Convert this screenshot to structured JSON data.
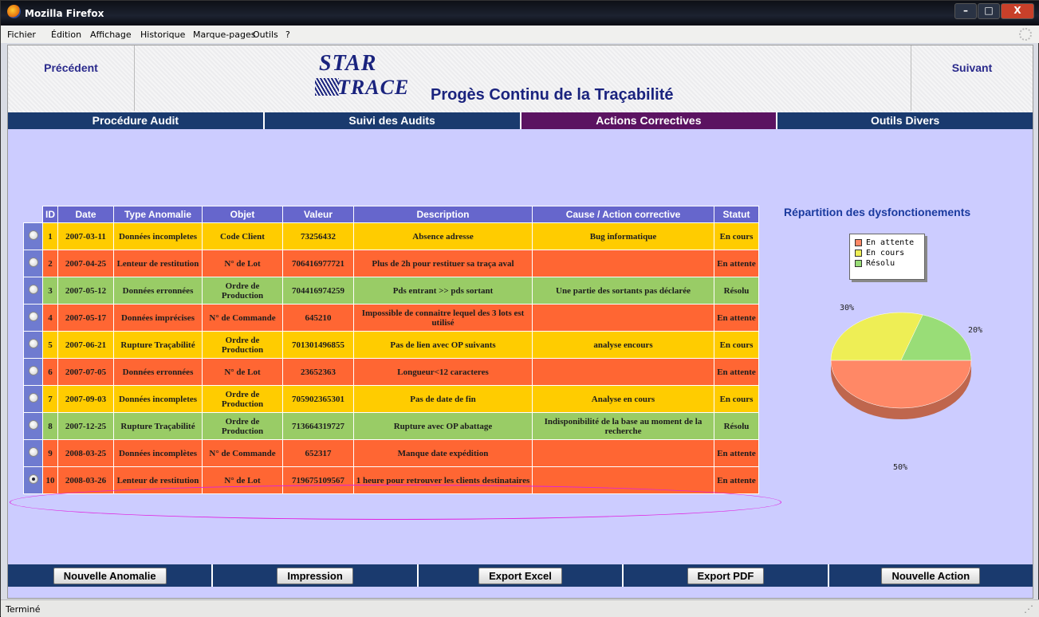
{
  "window": {
    "title": "Mozilla Firefox",
    "btn_min": "–",
    "btn_max": "□",
    "btn_close": "X"
  },
  "menu": [
    "Fichier",
    "Édition",
    "Affichage",
    "Historique",
    "Marque-pages",
    "Outils",
    "?"
  ],
  "banner": {
    "prev": "Précédent",
    "next": "Suivant",
    "logo_line1": "STAR",
    "logo_line2": "TRACE",
    "slogan": "Progès Continu de la Traçabilité"
  },
  "nav": [
    "Procédure Audit",
    "Suivi des Audits",
    "Actions Correctives",
    "Outils Divers"
  ],
  "table": {
    "headers": [
      "ID",
      "Date",
      "Type Anomalie",
      "Objet",
      "Valeur",
      "Description",
      "Cause / Action corrective",
      "Statut"
    ],
    "rows": [
      {
        "id": "1",
        "date": "2007-03-11",
        "type": "Données incompletes",
        "objet": "Code Client",
        "valeur": "73256432",
        "desc": "Absence adresse",
        "cause": "Bug informatique",
        "statut": "En cours",
        "color": "#ffcc00"
      },
      {
        "id": "2",
        "date": "2007-04-25",
        "type": "Lenteur de restitution",
        "objet": "N° de Lot",
        "valeur": "706416977721",
        "desc": "Plus de 2h pour restituer sa traça aval",
        "cause": "",
        "statut": "En attente",
        "color": "#ff6633"
      },
      {
        "id": "3",
        "date": "2007-05-12",
        "type": "Données erronnées",
        "objet": "Ordre de Production",
        "valeur": "704416974259",
        "desc": "Pds entrant >> pds sortant",
        "cause": "Une partie des sortants pas déclarée",
        "statut": "Résolu",
        "color": "#99cc66"
      },
      {
        "id": "4",
        "date": "2007-05-17",
        "type": "Données imprécises",
        "objet": "N° de Commande",
        "valeur": "645210",
        "desc": "Impossible de connaitre lequel des 3 lots est utilisé",
        "cause": "",
        "statut": "En attente",
        "color": "#ff6633"
      },
      {
        "id": "5",
        "date": "2007-06-21",
        "type": "Rupture Traçabilité",
        "objet": "Ordre de Production",
        "valeur": "701301496855",
        "desc": "Pas de lien avec OP suivants",
        "cause": "analyse encours",
        "statut": "En cours",
        "color": "#ffcc00"
      },
      {
        "id": "6",
        "date": "2007-07-05",
        "type": "Données erronnées",
        "objet": "N° de Lot",
        "valeur": "23652363",
        "desc": "Longueur<12 caracteres",
        "cause": "",
        "statut": "En attente",
        "color": "#ff6633"
      },
      {
        "id": "7",
        "date": "2007-09-03",
        "type": "Données incompletes",
        "objet": "Ordre de Production",
        "valeur": "705902365301",
        "desc": "Pas de date de fin",
        "cause": "Analyse en cours",
        "statut": "En cours",
        "color": "#ffcc00"
      },
      {
        "id": "8",
        "date": "2007-12-25",
        "type": "Rupture Traçabilité",
        "objet": "Ordre de Production",
        "valeur": "713664319727",
        "desc": "Rupture avec OP abattage",
        "cause": "Indisponibilité de la base au moment de la recherche",
        "statut": "Résolu",
        "color": "#99cc66"
      },
      {
        "id": "9",
        "date": "2008-03-25",
        "type": "Données incomplètes",
        "objet": "N° de Commande",
        "valeur": "652317",
        "desc": "Manque date expédition",
        "cause": "",
        "statut": "En attente",
        "color": "#ff6633"
      },
      {
        "id": "10",
        "date": "2008-03-26",
        "type": "Lenteur de restitution",
        "objet": "N° de Lot",
        "valeur": "719675109567",
        "desc": "1 heure pour retrouver les clients destinataires",
        "cause": "",
        "statut": "En attente",
        "color": "#ff6633",
        "selected": true
      }
    ]
  },
  "chart_data": {
    "type": "pie",
    "title": "Répartition des dysfonctionements",
    "categories": [
      "En attente",
      "En cours",
      "Résolu"
    ],
    "values": [
      50,
      30,
      20
    ],
    "labels": [
      "50%",
      "30%",
      "20%"
    ],
    "colors": [
      "#ff8866",
      "#eeee55",
      "#99dd77"
    ],
    "legend_position": "top-right"
  },
  "footer": [
    "Nouvelle Anomalie",
    "Impression",
    "Export Excel",
    "Export PDF",
    "Nouvelle Action"
  ],
  "status": {
    "text": "Terminé"
  }
}
